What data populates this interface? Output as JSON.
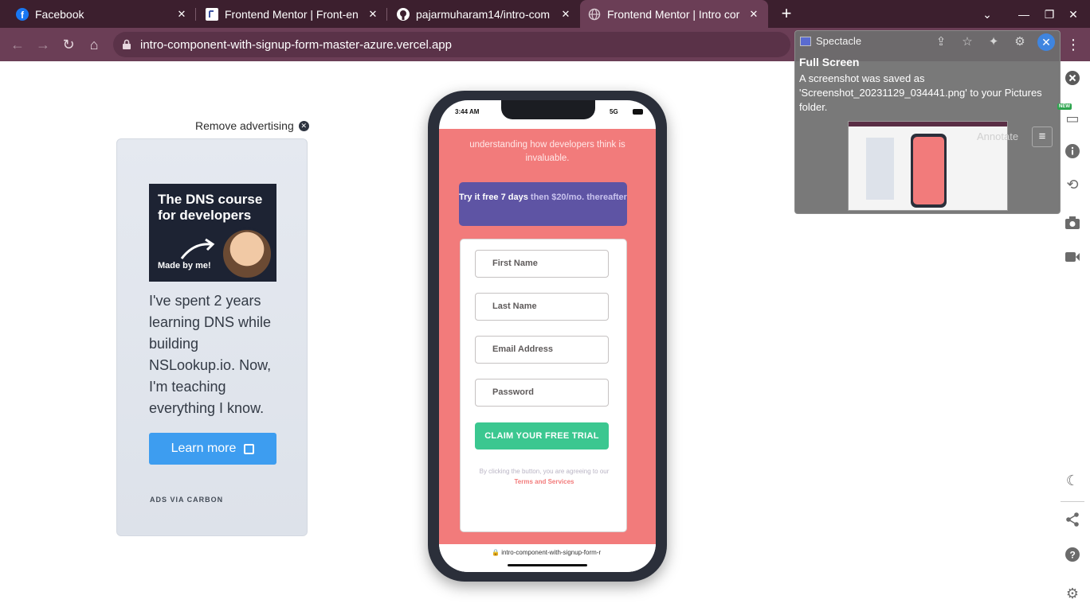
{
  "browser": {
    "tabs": [
      {
        "title": "Facebook",
        "active": false
      },
      {
        "title": "Frontend Mentor | Front-en",
        "active": false
      },
      {
        "title": "pajarmuharam14/intro-com",
        "active": false
      },
      {
        "title": "Frontend Mentor | Intro cor",
        "active": true
      }
    ],
    "new_tab": "+",
    "url": "intro-component-with-signup-form-master-azure.vercel.app",
    "colors": {
      "tabbar": "#3c1f2e",
      "toolbar": "#6b3e56"
    }
  },
  "ad": {
    "remove_label": "Remove advertising",
    "image_headline": "The DNS course for developers",
    "image_caption": "Made by me!",
    "text": "I've spent 2 years learning DNS while building NSLookup.io. Now, I'm teaching everything I know.",
    "button_label": "Learn more",
    "via_label": "ADS VIA CARBON"
  },
  "phone": {
    "status_time": "3:44 AM",
    "status_network": "5G",
    "lead_text": "understanding how developers think is invaluable.",
    "promo_bold": "Try it free 7 days",
    "promo_rest": "then $20/mo. thereafter",
    "fields": [
      {
        "placeholder": "First Name"
      },
      {
        "placeholder": "Last Name"
      },
      {
        "placeholder": "Email Address"
      },
      {
        "placeholder": "Password"
      }
    ],
    "cta_label": "CLAIM YOUR FREE TRIAL",
    "terms_prefix": "By clicking the button, you are agreeing to our",
    "terms_link": "Terms and Services",
    "bottom_url": "intro-component-with-signup-form-r",
    "colors": {
      "background": "#f27b7b",
      "promo": "#5e54a4",
      "cta": "#3bc790"
    }
  },
  "notification": {
    "app_name": "Spectacle",
    "title": "Full Screen",
    "body": "A screenshot was saved as 'Screenshot_20231129_034441.png' to your Pictures folder.",
    "annotate_label": "Annotate"
  },
  "sidebar": {
    "new_badge": "NEW",
    "icons": [
      "close-circle-icon",
      "responsive-device-icon",
      "info-icon",
      "rotate-icon",
      "camera-icon",
      "video-icon",
      "moon-icon",
      "share-icon",
      "help-icon",
      "settings-icon"
    ]
  }
}
